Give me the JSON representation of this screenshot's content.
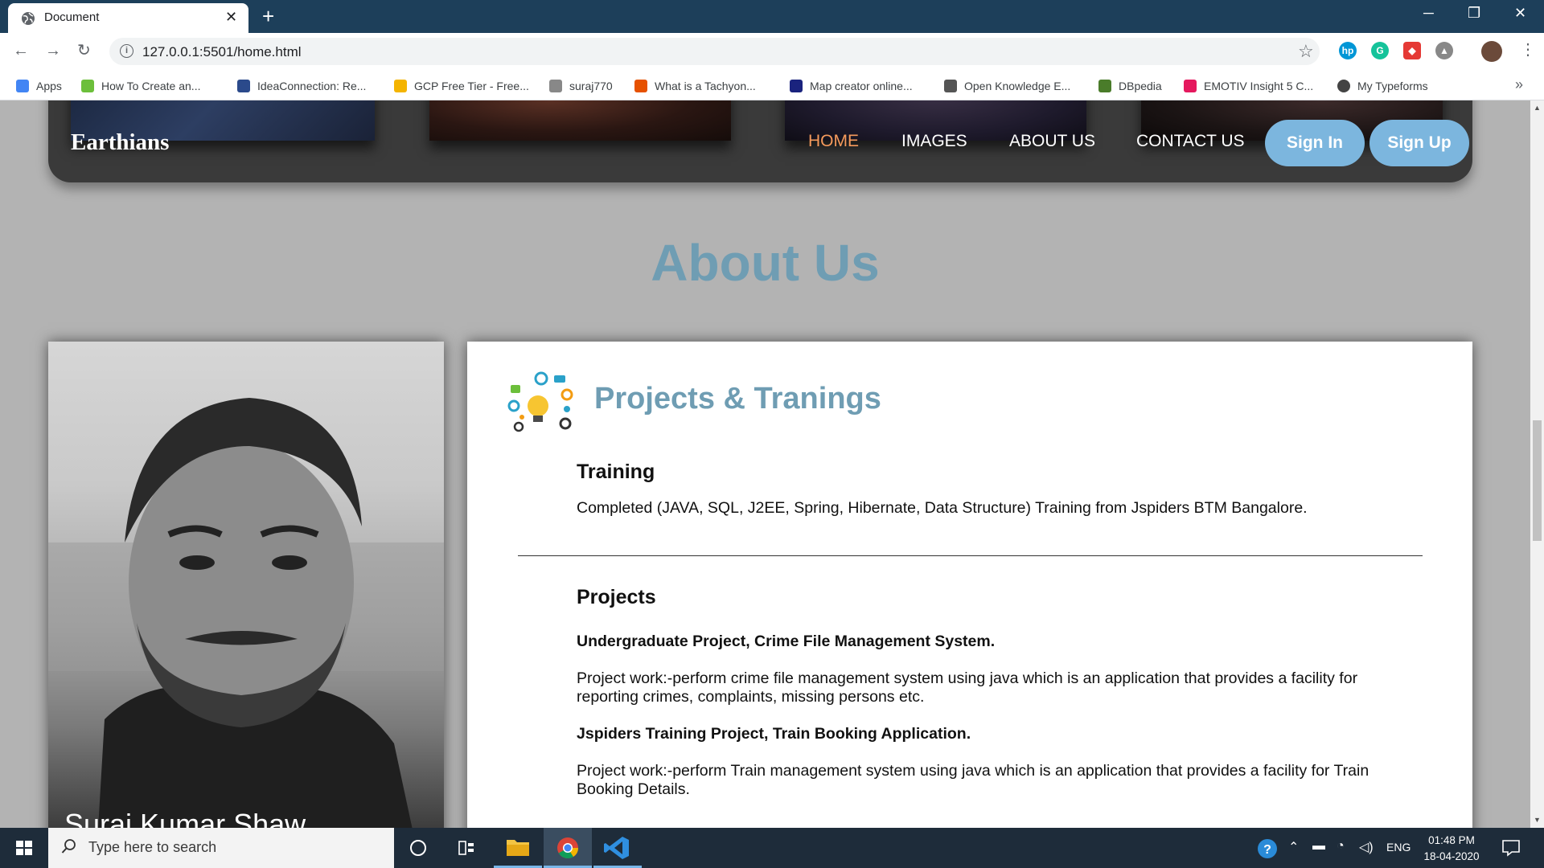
{
  "browser": {
    "tab_title": "Document",
    "url": "127.0.0.1:5501/home.html",
    "bookmarks": [
      {
        "label": "Apps",
        "icon": "apps-grid-icon",
        "color": "#4285f4"
      },
      {
        "label": "How To Create an...",
        "icon": "code-icon",
        "color": "#6cbf3b"
      },
      {
        "label": "IdeaConnection: Re...",
        "icon": "ideaconnection-icon",
        "color": "#2b4a8b"
      },
      {
        "label": "GCP Free Tier - Free...",
        "icon": "google-cloud-icon",
        "color": "#f4b400"
      },
      {
        "label": "suraj770",
        "icon": "dots-grid-icon",
        "color": "#888888"
      },
      {
        "label": "What is a Tachyon...",
        "icon": "tachyon-icon",
        "color": "#e65100"
      },
      {
        "label": "Map creator online...",
        "icon": "zm-icon",
        "color": "#1a237e"
      },
      {
        "label": "Open Knowledge E...",
        "icon": "globe-icon",
        "color": "#555555"
      },
      {
        "label": "DBpedia",
        "icon": "dbpedia-icon",
        "color": "#4a7c2a"
      },
      {
        "label": "EMOTIV Insight 5 C...",
        "icon": "emotiv-icon",
        "color": "#e5195e"
      },
      {
        "label": "My Typeforms",
        "icon": "typeform-icon",
        "color": "#444444"
      }
    ]
  },
  "site": {
    "logo": "Earthians",
    "nav": [
      "HOME",
      "IMAGES",
      "ABOUT US",
      "CONTACT US"
    ],
    "sign_in": "Sign In",
    "sign_up": "Sign Up",
    "accent_color": "#6f9db3",
    "active_nav_color": "#f59a5c",
    "button_color": "#7cb6de"
  },
  "about": {
    "title": "About Us",
    "name": "Suraj Kumar Shaw",
    "card_title": "Projects & Tranings",
    "training_heading": "Training",
    "training_text": "Completed (JAVA, SQL, J2EE, Spring, Hibernate, Data Structure) Training from Jspiders BTM Bangalore.",
    "projects_heading": "Projects",
    "projects": [
      {
        "title": "Undergraduate Project, Crime File Management System.",
        "description": "Project work:-perform crime file management system using java which is an application that provides a facility for reporting crimes, complaints, missing persons etc."
      },
      {
        "title": "Jspiders Training Project, Train Booking Application.",
        "description": "Project work:-perform Train management system using java which is an application that provides a facility for Train Booking Details."
      }
    ]
  },
  "taskbar": {
    "search_placeholder": "Type here to search",
    "language": "ENG",
    "time": "01:48 PM",
    "date": "18-04-2020"
  }
}
